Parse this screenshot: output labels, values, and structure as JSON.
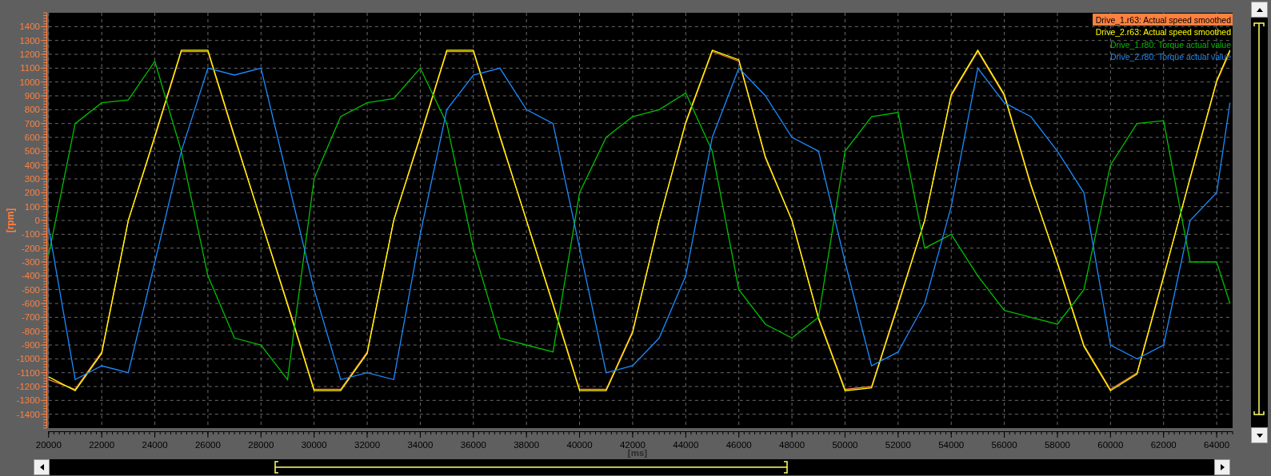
{
  "chart_data": {
    "type": "line",
    "xlabel": "[ms]",
    "ylabel": "[rpm]",
    "x": [
      20000,
      21000,
      22000,
      23000,
      24000,
      25000,
      26000,
      27000,
      28000,
      29000,
      30000,
      31000,
      32000,
      33000,
      34000,
      35000,
      36000,
      37000,
      38000,
      39000,
      40000,
      41000,
      42000,
      43000,
      44000,
      45000,
      46000,
      47000,
      48000,
      49000,
      50000,
      51000,
      52000,
      53000,
      54000,
      55000,
      56000,
      57000,
      58000,
      59000,
      60000,
      61000,
      62000,
      63000,
      64000,
      64500
    ],
    "series": [
      {
        "name": "Drive_1.r63: Actual speed smoothed",
        "color": "#ff8040",
        "values": [
          -1150,
          -1220,
          -950,
          0,
          600,
          1220,
          1220,
          600,
          0,
          -600,
          -1220,
          -1220,
          -950,
          0,
          600,
          1220,
          1220,
          600,
          0,
          -600,
          -1220,
          -1220,
          -800,
          0,
          700,
          1220,
          1150,
          450,
          0,
          -700,
          -1220,
          -1200,
          -600,
          0,
          900,
          1220,
          900,
          250,
          -300,
          -900,
          -1220,
          -1100,
          -400,
          300,
          1000,
          1220
        ]
      },
      {
        "name": "Drive_2.r63: Actual speed smoothed",
        "color": "#ffff00",
        "values": [
          -1130,
          -1230,
          -960,
          0,
          610,
          1230,
          1230,
          610,
          0,
          -610,
          -1230,
          -1230,
          -960,
          0,
          610,
          1230,
          1230,
          610,
          0,
          -610,
          -1230,
          -1230,
          -810,
          0,
          710,
          1230,
          1160,
          460,
          0,
          -710,
          -1230,
          -1210,
          -610,
          0,
          910,
          1230,
          910,
          260,
          -310,
          -910,
          -1230,
          -1110,
          -410,
          310,
          1010,
          1230
        ]
      },
      {
        "name": "Drive_1.r80: Torque actual value",
        "color": "#00c000",
        "values": [
          -250,
          700,
          850,
          870,
          1150,
          500,
          -400,
          -850,
          -900,
          -1150,
          300,
          750,
          850,
          880,
          1100,
          700,
          -200,
          -850,
          -900,
          -950,
          200,
          600,
          750,
          800,
          920,
          500,
          -500,
          -750,
          -850,
          -700,
          500,
          750,
          780,
          -200,
          -100,
          -400,
          -650,
          -700,
          -750,
          -500,
          400,
          700,
          720,
          -300,
          -300,
          -600
        ]
      },
      {
        "name": "Drive_2.r80: Torque actual value",
        "color": "#1a8cff",
        "values": [
          -50,
          -1150,
          -1050,
          -1100,
          -300,
          500,
          1100,
          1050,
          1100,
          300,
          -500,
          -1150,
          -1100,
          -1150,
          -100,
          800,
          1050,
          1100,
          800,
          700,
          -200,
          -1100,
          -1050,
          -850,
          -400,
          600,
          1100,
          900,
          600,
          500,
          -300,
          -1050,
          -950,
          -600,
          100,
          1100,
          850,
          750,
          500,
          200,
          -900,
          -1000,
          -900,
          0,
          200,
          850
        ]
      }
    ],
    "grid": true,
    "xlim": [
      20000,
      64600
    ],
    "ylim": [
      -1500,
      1500
    ],
    "xticks": [
      20000,
      22000,
      24000,
      26000,
      28000,
      30000,
      32000,
      34000,
      36000,
      38000,
      40000,
      42000,
      44000,
      46000,
      48000,
      50000,
      52000,
      54000,
      56000,
      58000,
      60000,
      62000,
      64000
    ],
    "yticks": [
      1400,
      1300,
      1200,
      1100,
      1000,
      900,
      800,
      700,
      600,
      500,
      400,
      300,
      200,
      100,
      0,
      -100,
      -200,
      -300,
      -400,
      -500,
      -600,
      -700,
      -800,
      -900,
      -1000,
      -1100,
      -1200,
      -1300,
      -1400
    ]
  },
  "legend": [
    {
      "selected": true
    },
    {
      "selected": false
    },
    {
      "selected": false
    },
    {
      "selected": false
    }
  ]
}
